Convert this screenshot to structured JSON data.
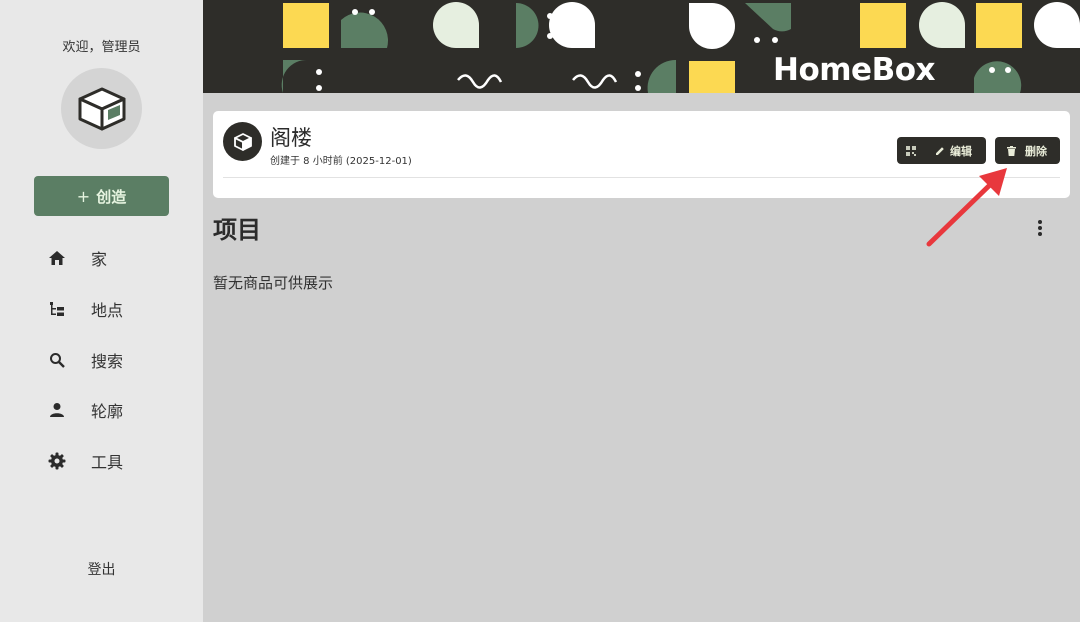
{
  "sidebar": {
    "welcome": "欢迎，管理员",
    "create_label": "创造",
    "create_icon": "plus-icon",
    "items": [
      {
        "label": "家",
        "icon": "home-icon"
      },
      {
        "label": "地点",
        "icon": "tree-icon"
      },
      {
        "label": "搜索",
        "icon": "search-icon"
      },
      {
        "label": "轮廓",
        "icon": "person-icon"
      },
      {
        "label": "工具",
        "icon": "gear-icon"
      }
    ],
    "logout": "登出"
  },
  "banner": {
    "brand": "HomeBox"
  },
  "location": {
    "name": "阁楼",
    "created": "创建于 8 小时前 (2025-12-01)",
    "edit_label": "编辑",
    "delete_label": "删除"
  },
  "items_section": {
    "title": "项目",
    "empty": "暂无商品可供展示"
  },
  "colors": {
    "accent": "#5b7e64",
    "dark": "#2e2d29",
    "yellow": "#fcd952",
    "annotation": "#e8383d"
  }
}
